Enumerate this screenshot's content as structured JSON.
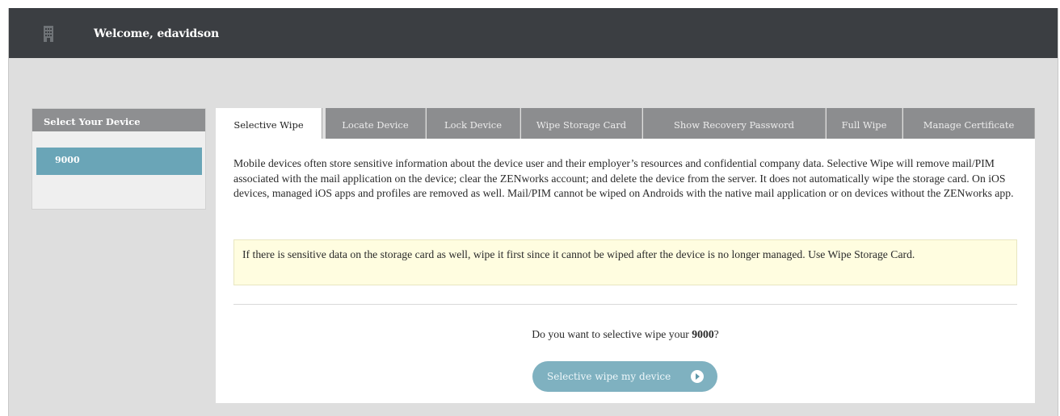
{
  "header": {
    "welcome": "Welcome, edavidson",
    "logo_icon": "building-icon"
  },
  "sidebar": {
    "title": "Select Your Device",
    "devices": [
      {
        "label": "9000",
        "selected": true
      }
    ]
  },
  "tabs": [
    {
      "label": "Selective Wipe",
      "active": true
    },
    {
      "label": "Locate Device",
      "active": false
    },
    {
      "label": "Lock Device",
      "active": false
    },
    {
      "label": "Wipe Storage Card",
      "active": false
    },
    {
      "label": "Show Recovery Password",
      "active": false
    },
    {
      "label": "Full Wipe",
      "active": false
    },
    {
      "label": "Manage Certificate",
      "active": false
    }
  ],
  "main": {
    "description": "Mobile devices often store sensitive information about the device user and their employer’s resources and confidential company data. Selective Wipe will remove mail/PIM associated with the mail application on the device; clear the ZENworks account; and delete the device from the server. It does not automatically wipe the storage card. On iOS devices, managed iOS apps and profiles are removed as well. Mail/PIM cannot be wiped on Androids with the native mail application or on devices without the ZENworks app.",
    "notice": "If there is sensitive data on the storage card as well, wipe it first since it cannot be wiped after the device is no longer managed. Use Wipe Storage Card.",
    "question_prefix": "Do you want to selective wipe your ",
    "question_device": "9000",
    "question_suffix": "?",
    "button_label": "Selective wipe my device",
    "button_icon": "arrow-right-circle-icon"
  },
  "colors": {
    "topbar": "#3b3e42",
    "accent": "#6aa5b7",
    "tab_inactive": "#8c8d8f",
    "notice_bg": "#fffde0"
  }
}
